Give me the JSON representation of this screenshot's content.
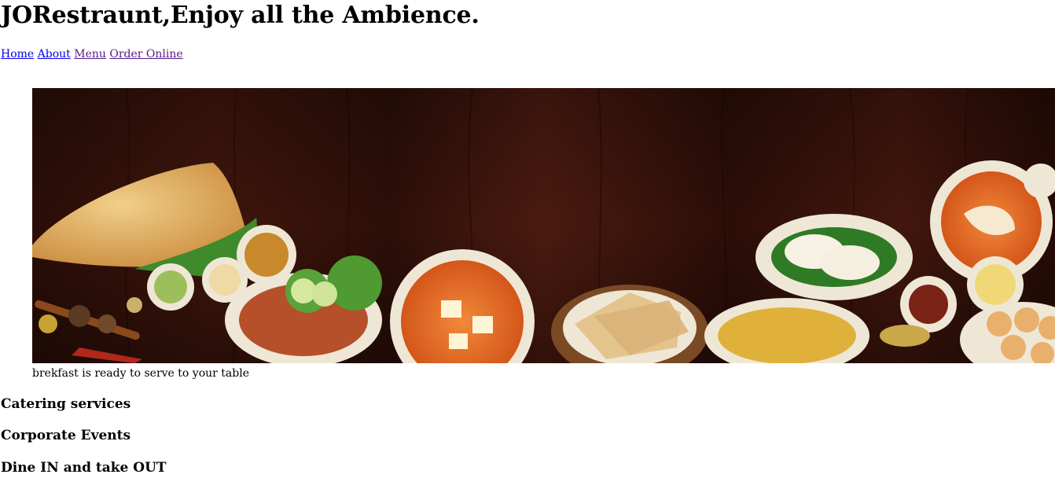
{
  "header": {
    "title": "JORestraunt,Enjoy all the Ambience."
  },
  "nav": {
    "items": [
      {
        "label": "Home",
        "visited": false
      },
      {
        "label": "About",
        "visited": false
      },
      {
        "label": "Menu",
        "visited": true
      },
      {
        "label": "Order Online",
        "visited": true
      }
    ]
  },
  "hero": {
    "caption": "brekfast is ready to serve to your table",
    "colors": {
      "wood_dark": "#2a0d07",
      "wood_mid": "#4a1a0f",
      "plate": "#f2ece0",
      "curry": "#e0661c"
    }
  },
  "services": [
    {
      "title": "Catering services"
    },
    {
      "title": "Corporate Events"
    },
    {
      "title": "Dine IN and take OUT"
    }
  ]
}
